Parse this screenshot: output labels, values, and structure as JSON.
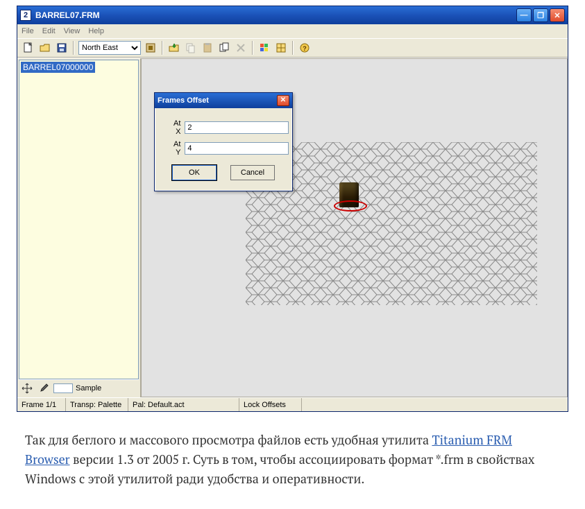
{
  "window": {
    "title": "BARREL07.FRM",
    "appicon_char": "2"
  },
  "menu": {
    "file": "File",
    "edit": "Edit",
    "view": "View",
    "help": "Help"
  },
  "toolbar": {
    "direction_selected": "North East"
  },
  "framelist": {
    "items": [
      "BARREL07000000"
    ]
  },
  "bottom_tools": {
    "sample_label": "Sample"
  },
  "dialog": {
    "title": "Frames Offset",
    "atx_label": "At X",
    "aty_label": "At Y",
    "atx_value": "2",
    "aty_value": "4",
    "ok": "OK",
    "cancel": "Cancel"
  },
  "statusbar": {
    "frame": "Frame 1/1",
    "transp": "Transp: Palette",
    "palette": "Pal: Default.act",
    "lock": "Lock Offsets"
  },
  "article": {
    "prefix": "Так для беглого и массового просмотра файлов есть удобная утилита ",
    "link": "Titanium FRM Browser",
    "suffix": " версии 1.3 от 2005 г. Суть в том, чтобы ассоциировать формат *.frm в свойствах Windows с этой утилитой ради удобства и оперативности."
  }
}
